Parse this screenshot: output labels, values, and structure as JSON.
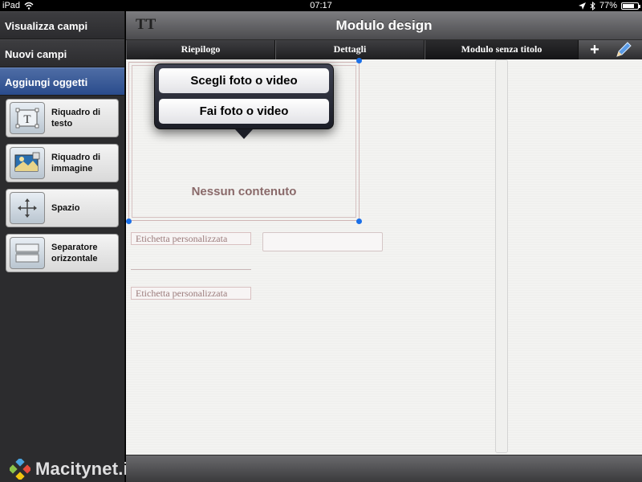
{
  "status": {
    "carrier": "iPad",
    "time": "07:17",
    "battery": "77%",
    "battery_level": 0.77
  },
  "sidebar": {
    "rows": [
      {
        "label": "Visualizza campi"
      },
      {
        "label": "Nuovi campi"
      },
      {
        "label": "Aggiungi oggetti"
      }
    ],
    "objects": [
      {
        "label": "Riquadro di\ntesto",
        "icon": "text-box-icon"
      },
      {
        "label": "Riquadro di\nimmagine",
        "icon": "image-box-icon"
      },
      {
        "label": "Spazio",
        "icon": "move-arrows-icon"
      },
      {
        "label": "Separatore\norizzontale",
        "icon": "horizontal-separator-icon"
      }
    ],
    "watermark": "Macitynet.it"
  },
  "navbar": {
    "title": "Modulo design",
    "font_icon": "TT"
  },
  "tabs": [
    {
      "label": "Riepilogo"
    },
    {
      "label": "Dettagli"
    },
    {
      "label": "Modulo senza titolo"
    }
  ],
  "tabbar": {
    "plus": "+"
  },
  "canvas": {
    "no_content": "Nessun contenuto",
    "custom_label_1": "Etichetta personalizzata",
    "custom_label_2": "Etichetta personalizzata"
  },
  "popover": {
    "choose": "Scegli foto o video",
    "take": "Fai foto o video"
  },
  "colors": {
    "accent": "#2a4c8c",
    "handle": "#1a6fe8",
    "no_content_text": "#8a6a6a"
  }
}
